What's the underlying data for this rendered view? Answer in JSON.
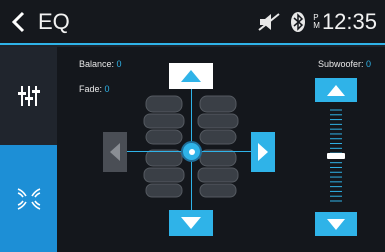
{
  "header": {
    "back_icon": "chevron-left-icon",
    "title": "EQ",
    "status": {
      "mute_icon": "speaker-muted-icon",
      "bluetooth_icon": "bluetooth-icon",
      "ampm_top": "P",
      "ampm_bottom": "M",
      "time": "12:35"
    }
  },
  "sidebar": {
    "items": [
      {
        "name": "eq",
        "icon": "equalizer-sliders-icon",
        "selected": false
      },
      {
        "name": "surround",
        "icon": "surround-speakers-icon",
        "selected": true
      }
    ]
  },
  "balance": {
    "label": "Balance:",
    "value": "0"
  },
  "fade": {
    "label": "Fade:",
    "value": "0"
  },
  "subwoofer": {
    "label": "Subwoofer:",
    "value": "0",
    "level_fraction": 0.5
  },
  "colors": {
    "accent": "#2fb3e8",
    "header_bg": "#15181d",
    "selected_tab": "#1d8fd6",
    "panel_bg": "#14171c"
  }
}
